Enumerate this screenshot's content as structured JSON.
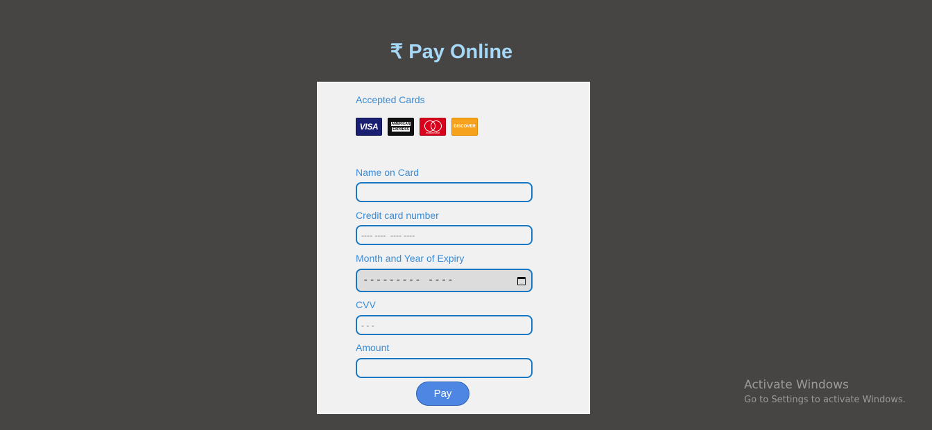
{
  "page": {
    "title": "₹ Pay Online"
  },
  "form": {
    "accepted_cards_label": "Accepted Cards",
    "accepted_cards": [
      {
        "name": "VISA"
      },
      {
        "name": "AMERICAN EXPRESS",
        "line1": "AMERICAN",
        "line2": "EXPRESS"
      },
      {
        "name": "MasterCard",
        "text": "mastercard"
      },
      {
        "name": "DISCOVER"
      }
    ],
    "name_label": "Name on Card",
    "name_value": "",
    "card_number_label": "Credit card number",
    "card_number_placeholder": "---- ----  ---- ----",
    "expiry_label": "Month and Year of Expiry",
    "expiry_value": "--------- ----",
    "cvv_label": "CVV",
    "cvv_placeholder": "- - -",
    "amount_label": "Amount",
    "amount_value": "",
    "pay_button": "Pay"
  },
  "watermark": {
    "title": "Activate Windows",
    "subtitle": "Go to Settings to activate Windows."
  },
  "colors": {
    "background": "#474543",
    "title": "#a6d8f7",
    "label": "#3a8bd6",
    "field_border": "#1677c5",
    "button": "#4e86e4"
  }
}
